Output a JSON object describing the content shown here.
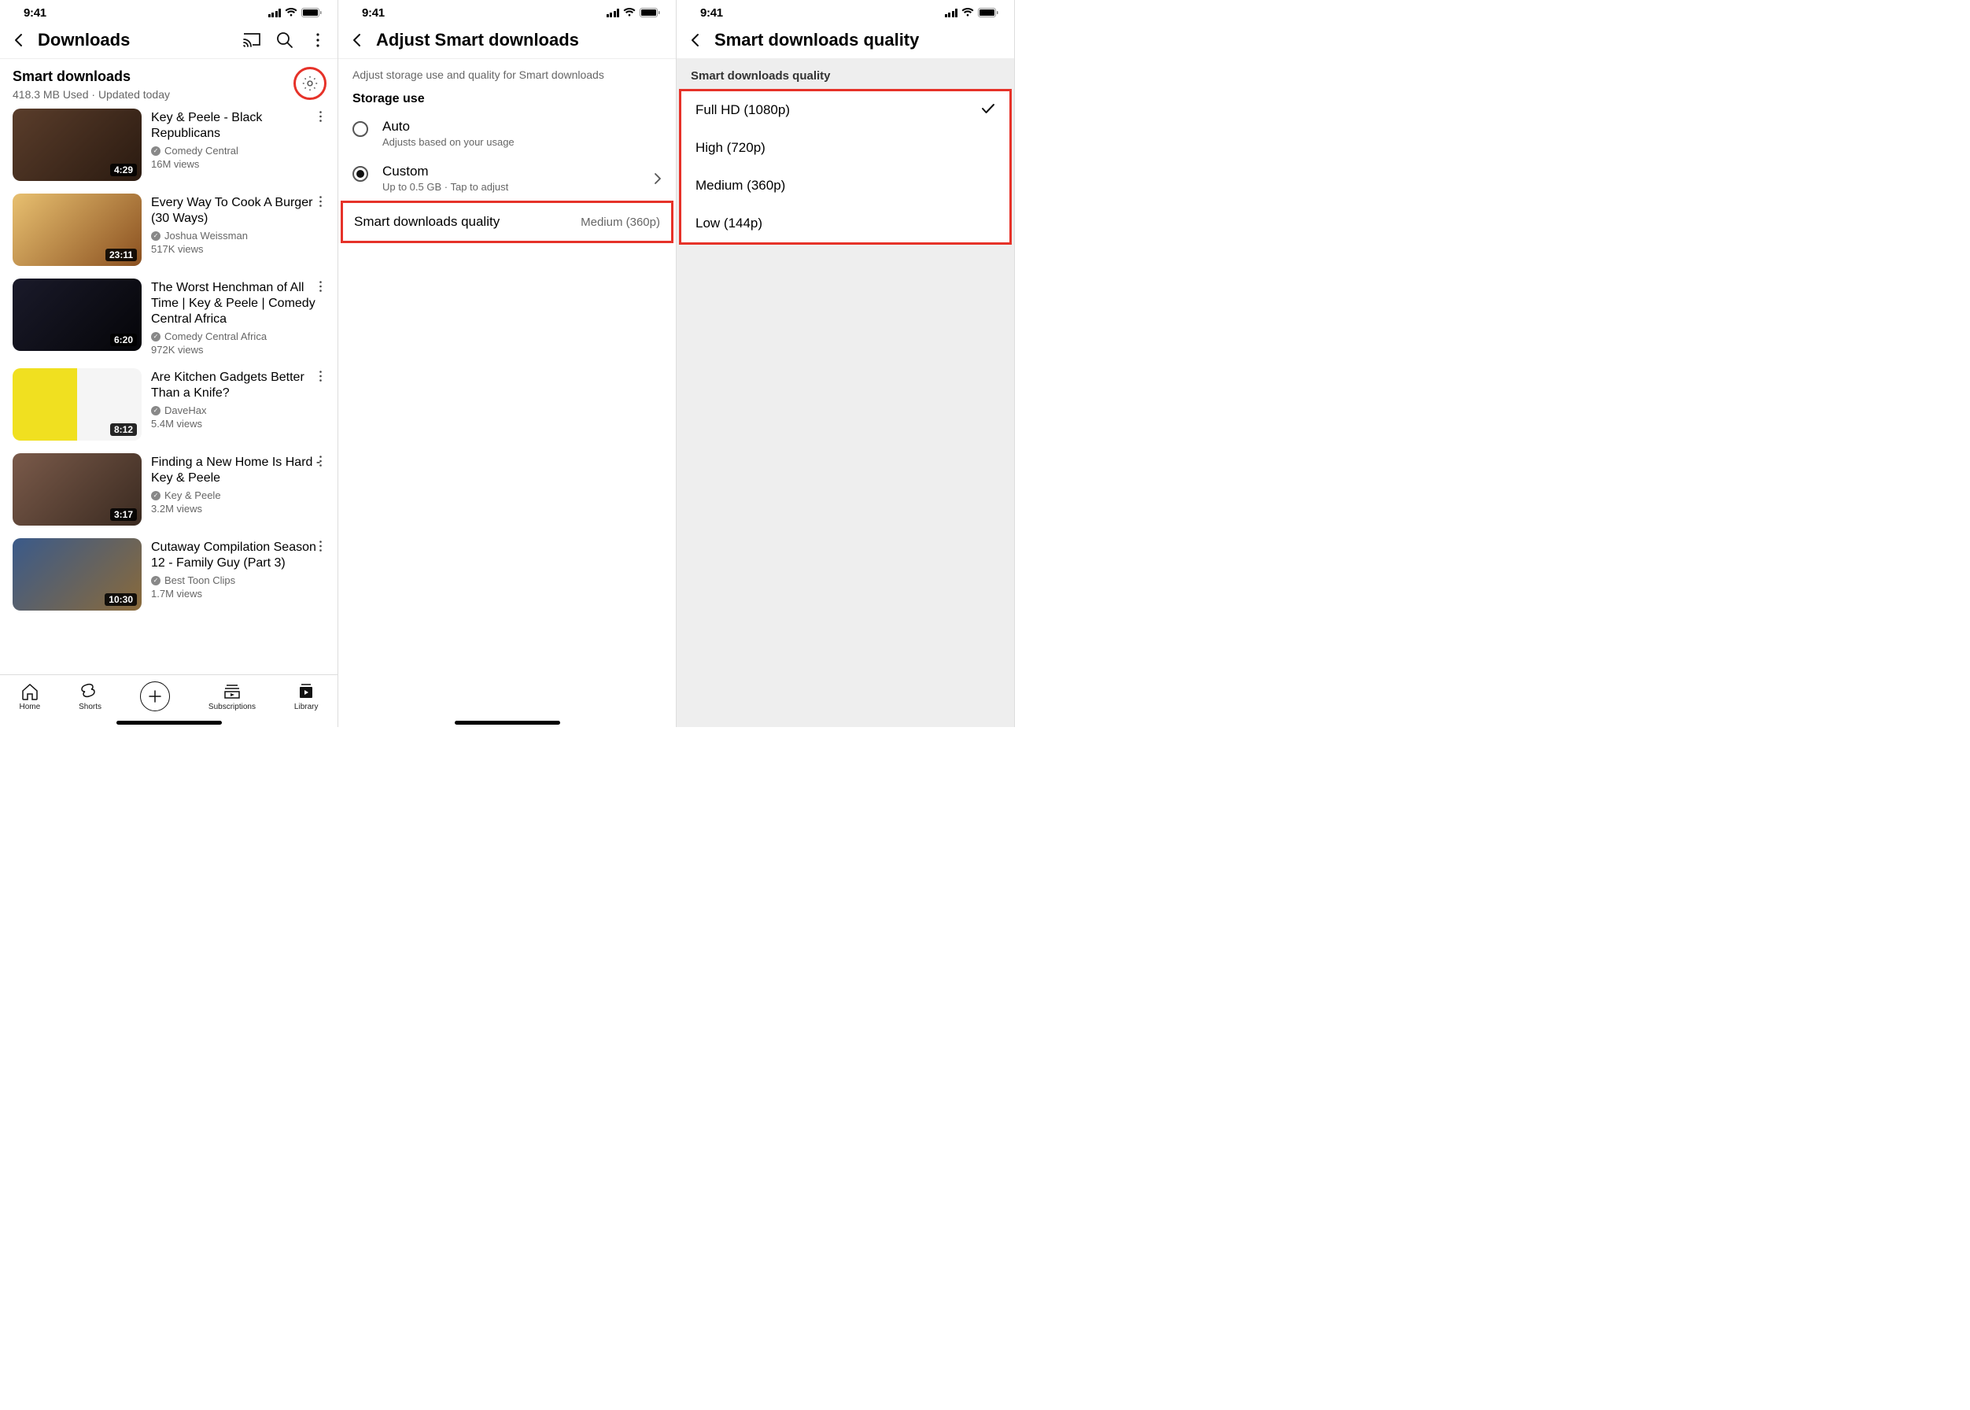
{
  "status": {
    "time": "9:41"
  },
  "panel1": {
    "title": "Downloads",
    "smart": {
      "title": "Smart downloads",
      "subtitle": "418.3 MB Used · Updated today"
    },
    "videos": [
      {
        "title": "Key & Peele - Black Republicans",
        "channel": "Comedy Central",
        "views": "16M views",
        "duration": "4:29"
      },
      {
        "title": "Every Way To Cook A Burger (30 Ways)",
        "channel": "Joshua Weissman",
        "views": "517K views",
        "duration": "23:11"
      },
      {
        "title": "The Worst Henchman of All Time | Key & Peele | Comedy Central Africa",
        "channel": "Comedy Central Africa",
        "views": "972K views",
        "duration": "6:20"
      },
      {
        "title": "Are Kitchen Gadgets Better Than a Knife?",
        "channel": "DaveHax",
        "views": "5.4M views",
        "duration": "8:12"
      },
      {
        "title": "Finding a New Home Is Hard - Key & Peele",
        "channel": "Key & Peele",
        "views": "3.2M views",
        "duration": "3:17"
      },
      {
        "title": "Cutaway Compilation Season 12 - Family Guy (Part 3)",
        "channel": "Best Toon Clips",
        "views": "1.7M views",
        "duration": "10:30"
      }
    ],
    "nav": {
      "home": "Home",
      "shorts": "Shorts",
      "subscriptions": "Subscriptions",
      "library": "Library"
    }
  },
  "panel2": {
    "title": "Adjust Smart downloads",
    "subhead": "Adjust storage use and quality for Smart downloads",
    "storage_label": "Storage use",
    "auto": {
      "title": "Auto",
      "sub": "Adjusts based on your usage"
    },
    "custom": {
      "title": "Custom",
      "sub": "Up to 0.5 GB · Tap to adjust"
    },
    "quality_row": {
      "label": "Smart downloads quality",
      "value": "Medium (360p)"
    }
  },
  "panel3": {
    "title": "Smart downloads quality",
    "list_label": "Smart downloads quality",
    "options": [
      {
        "label": "Full HD (1080p)",
        "selected": true
      },
      {
        "label": "High (720p)",
        "selected": false
      },
      {
        "label": "Medium (360p)",
        "selected": false
      },
      {
        "label": "Low (144p)",
        "selected": false
      }
    ]
  }
}
